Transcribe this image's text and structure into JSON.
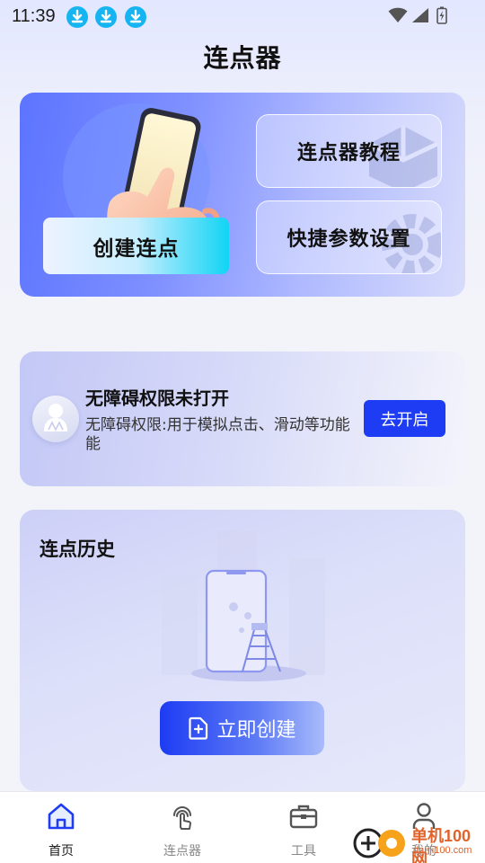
{
  "status_bar": {
    "time": "11:39",
    "notifications": [
      "download-icon",
      "download-icon",
      "download-icon"
    ],
    "system_icons": [
      "wifi-icon",
      "signal-icon",
      "battery-icon"
    ]
  },
  "header": {
    "title": "连点器"
  },
  "hero": {
    "create_label": "创建连点",
    "tutorial_label": "连点器教程",
    "settings_label": "快捷参数设置"
  },
  "accessibility": {
    "title": "无障碍权限未打开",
    "description": "无障碍权限:用于模拟点击、滑动等功能能",
    "button_label": "去开启"
  },
  "history": {
    "title": "连点历史",
    "button_label": "立即创建"
  },
  "bottom_nav": {
    "items": [
      {
        "label": "首页",
        "icon": "home-icon",
        "active": true
      },
      {
        "label": "连点器",
        "icon": "tap-icon",
        "active": false
      },
      {
        "label": "工具",
        "icon": "toolbox-icon",
        "active": false
      },
      {
        "label": "我的",
        "icon": "user-icon",
        "active": false
      }
    ]
  },
  "watermark": {
    "brand": "单机100网",
    "url": "danji100.com"
  },
  "colors": {
    "accent": "#1d3cf3",
    "hero_start": "#5c74ff",
    "active_nav": "#1d3cf3",
    "watermark": "#e0632a"
  }
}
